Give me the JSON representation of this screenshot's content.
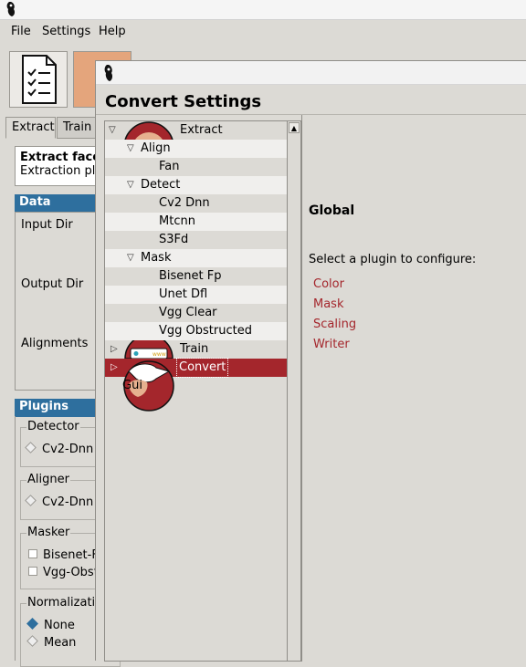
{
  "menubar": {
    "file": "File",
    "settings": "Settings",
    "help": "Help"
  },
  "tabs": [
    "Extract",
    "Train"
  ],
  "info": {
    "title": "Extract face",
    "subtitle": "Extraction plu"
  },
  "data_section": {
    "header": "Data",
    "input_dir": "Input Dir",
    "output_dir": "Output Dir",
    "alignments": "Alignments"
  },
  "plugins_section": {
    "header": "Plugins",
    "detector": {
      "legend": "Detector",
      "option": "Cv2-Dnn"
    },
    "aligner": {
      "legend": "Aligner",
      "option": "Cv2-Dnn"
    },
    "masker": {
      "legend": "Masker",
      "options": [
        "Bisenet-Fp",
        "Vgg-Obstr"
      ]
    },
    "normalization": {
      "legend": "Normalizatio",
      "options": [
        "None",
        "Mean"
      ],
      "selected": "None"
    }
  },
  "dialog": {
    "title": "Convert Settings",
    "tree": [
      {
        "label": "Extract",
        "level": 0,
        "expanded": true,
        "has_icon": true
      },
      {
        "label": "Align",
        "level": 1,
        "expanded": true
      },
      {
        "label": "Fan",
        "level": 2
      },
      {
        "label": "Detect",
        "level": 1,
        "expanded": true
      },
      {
        "label": "Cv2 Dnn",
        "level": 2
      },
      {
        "label": "Mtcnn",
        "level": 2
      },
      {
        "label": "S3Fd",
        "level": 2
      },
      {
        "label": "Mask",
        "level": 1,
        "expanded": true
      },
      {
        "label": "Bisenet Fp",
        "level": 2
      },
      {
        "label": "Unet Dfl",
        "level": 2
      },
      {
        "label": "Vgg Clear",
        "level": 2
      },
      {
        "label": "Vgg Obstructed",
        "level": 2
      },
      {
        "label": "Train",
        "level": 0,
        "expanded": false,
        "has_icon": true
      },
      {
        "label": "Convert",
        "level": 0,
        "expanded": false,
        "has_icon": true,
        "selected": true
      },
      {
        "label": "Gui",
        "level": 0
      }
    ],
    "right": {
      "heading": "Global",
      "prompt": "Select a plugin to configure:",
      "plugins": [
        "Color",
        "Mask",
        "Scaling",
        "Writer"
      ]
    }
  },
  "colors": {
    "accent": "#a4262c",
    "section_header": "#2e6f9e",
    "background": "#dcdad5"
  }
}
